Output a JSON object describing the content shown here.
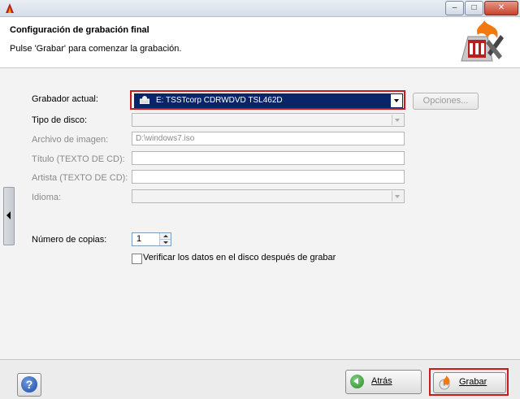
{
  "window": {
    "minimize_glyph": "–",
    "maximize_glyph": "□",
    "close_glyph": "✕"
  },
  "header": {
    "title": "Configuración de grabación final",
    "subtitle": "Pulse 'Grabar' para comenzar la grabación."
  },
  "form": {
    "recorder_label": "Grabador actual:",
    "recorder_value": "E: TSSTcorp CDRWDVD TSL462D",
    "options_button": "Opciones...",
    "disc_type_label": "Tipo de disco:",
    "image_file_label": "Archivo de imagen:",
    "image_file_value": "D:\\windows7.iso",
    "title_label": "Título (TEXTO DE CD):",
    "artist_label": "Artista (TEXTO DE CD):",
    "language_label": "Idioma:",
    "copies_label": "Número de copias:",
    "copies_value": "1",
    "verify_label": "Verificar los datos en el disco después de grabar",
    "verify_checked": false
  },
  "footer": {
    "help_glyph": "?",
    "back_label": "Atrás",
    "burn_label": "Grabar"
  },
  "colors": {
    "highlight_border": "#cc1a1a",
    "selection_bg": "#0a246a"
  }
}
